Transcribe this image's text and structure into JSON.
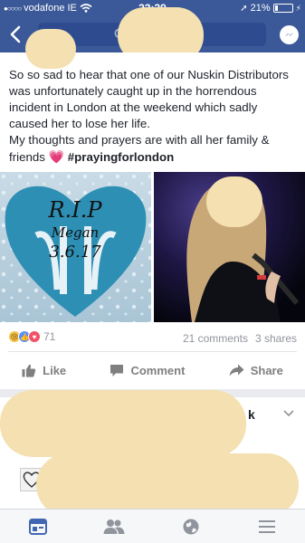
{
  "status": {
    "carrier": "vodafone IE",
    "time": "23:39",
    "battery": "21%",
    "battery_level": 0.21
  },
  "post": {
    "text_main": "So so sad to hear that one of our Nuskin Distributors was unfortunately caught up in the horrendous incident in London at the weekend which sadly caused her to lose her life.",
    "text_line2": "My thoughts and prayers are with all her family & friends",
    "hashtag": "#prayingforlondon",
    "image_left": {
      "line1": "R.I.P",
      "line2": "Megan",
      "line3": "3.6.17"
    },
    "reaction_count": "71",
    "comments": "21 comments",
    "shares": "3 shares",
    "like_label": "Like",
    "comment_label": "Comment",
    "share_label": "Share"
  },
  "next_post": {
    "fragment": "k"
  },
  "colors": {
    "brand": "#3b5998",
    "redaction": "#f4e0b0"
  },
  "icons": {
    "back": "back-chevron-icon",
    "search": "search-icon",
    "messenger": "messenger-icon"
  }
}
